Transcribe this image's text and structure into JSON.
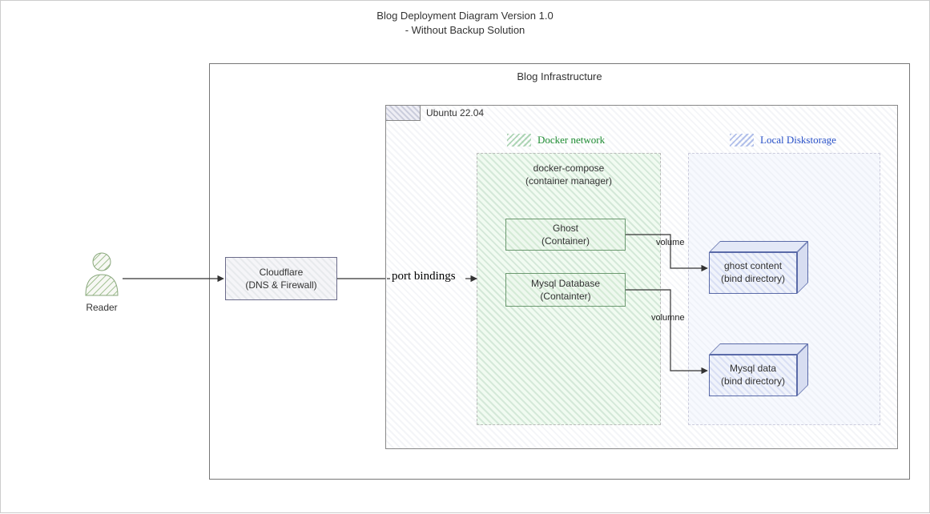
{
  "title_line1": "Blog Deployment Diagram Version 1.0",
  "title_line2": "- Without Backup Solution",
  "reader_label": "Reader",
  "cloudflare": {
    "line1": "Cloudflare",
    "line2": "(DNS & Firewall)"
  },
  "port_binding_label": "port bindings",
  "infra_label": "Blog Infrastructure",
  "ubuntu_label": "Ubuntu 22.04",
  "docker_network_label": "Docker network",
  "local_disk_label": "Local Diskstorage",
  "compose": {
    "line1": "docker-compose",
    "line2": "(container manager)"
  },
  "ghost": {
    "line1": "Ghost",
    "line2": "(Container)"
  },
  "mysql": {
    "line1": "Mysql Database",
    "line2": "(Containter)"
  },
  "volume_label_top": "volume",
  "volume_label_bottom": "volumne",
  "ghost_store": {
    "line1": "ghost content",
    "line2": "(bind directory)"
  },
  "mysql_store": {
    "line1": "Mysql data",
    "line2": "(bind directory)"
  }
}
